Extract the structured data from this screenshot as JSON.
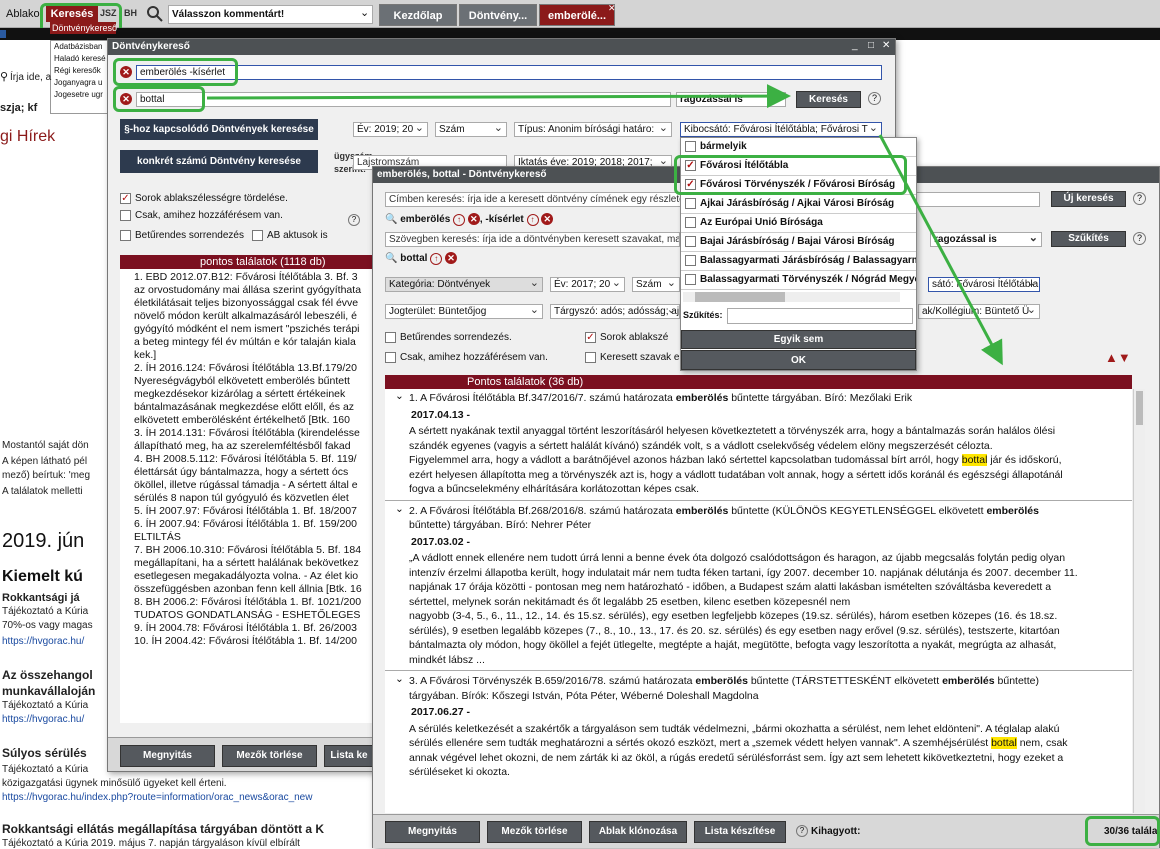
{
  "topbar": {
    "app": "Ablako",
    "search_tab": "Keresés",
    "badge": "JSZ",
    "badge2": "BH",
    "comment_placeholder": "Válasszon kommentárt!",
    "tabs": [
      "Kezdőlap",
      "Döntvény...",
      "emberölé..."
    ]
  },
  "menu": {
    "items": [
      "Döntvénykereső",
      "Adatbázisban",
      "Haladó keresé",
      "Régi keresők",
      "Joganyagra u",
      "Jogesetre ugr"
    ]
  },
  "bg": {
    "search_ph": "Írja ide, a",
    "szja": "szja; kf",
    "news": "gi Hírek",
    "notice1": "Mostantól saját dön",
    "notice2": "A képen látható pél",
    "notice3": "mező) beírtuk: 'meg",
    "notice4": "A találatok melletti",
    "date": "2019. jún",
    "h1": "Kiemelt kú",
    "h1b": "Rokkantsági já",
    "t1": "Tájékoztató a Kúria",
    "t2": "70%-os vagy magas",
    "link1": "https://hvgorac.hu/",
    "h2a": "Az összehangol",
    "h2b": "munkavállaloján",
    "t3": "Tájékoztató a Kúria",
    "link2": "https://hvgorac.hu/",
    "h3": "Súlyos sérülés",
    "t4": "Tájékoztató a Kúria",
    "t5": "közigazgatási ügynek minősülő ügyeket kell érteni.",
    "link3": "https://hvgorac.hu/index.php?route=information/orac_news&orac_new",
    "h4": "Rokkantsági ellátás megállapítása tárgyában döntött a K",
    "t6": "Tájékoztató a Kúria 2019. május 7. napján tárgyaláson kívül elbírált"
  },
  "w1": {
    "title": "Döntvénykereső",
    "q1": "emberölés -kísérlet",
    "q2": "bottal",
    "ragoz": "ragozással is",
    "search_btn": "Keresés",
    "btn_para": "§-hoz kapcsolódó Döntvények keresése",
    "btn_num": "konkrét számú Döntvény keresése",
    "ev": "Év: 2019; 20",
    "szam": "Szám",
    "tipus": "Típus: Anonim bírósági határo:",
    "kibocsato": "Kibocsátó: Fővárosi Ítélőtábla; Fővárosi T",
    "ugyszam": "ügyszám",
    "szerint": "szerint:",
    "lajstrom": "Lajstromszám",
    "iktatas": "Iktatás éve: 2019; 2018; 2017;",
    "opt1": "Sorok ablakszélességre tördelése.",
    "opt2": "Csak, amihez hozzáférésem van.",
    "opt3": "Betűrendes sorrendezés",
    "opt4": "AB aktusok is",
    "results_header": "pontos találatok (1118 db)",
    "lines": [
      "1. EBD 2012.07.B12: Fővárosi Ítélőtábla 3. Bf. 3",
      "az orvostudomány mai állása szerint gyógyíthata",
      "életkilátásait teljes bizonyossággal csak fél évve",
      "növelő módon került alkalmazásáról lebeszéli, é",
      "gyógyító módként el nem ismert \"pszichés terápi",
      "a beteg mintegy fél év múltán e kór talaján kiala",
      "kek.]",
      "2. ÍH 2016.124: Fővárosi Ítélőtábla 13.Bf.179/20",
      "Nyereségvágyból elkövetett emberölés bűntett",
      "megkezdésekor kizárólag a sértett értékeinek",
      "bántalmazásának megkezdése előtt előll, és az",
      "elkövetett emberölésként értékelhető [Btk. 160",
      "3. ÍH 2014.131: Fővárosi Ítélőtábla (kirendelésse",
      "állapítható meg, ha az szerelemféltésből fakad",
      "4. BH 2008.5.112: Fővárosi Ítélőtábla 5. Bf. 119/",
      "élettársát úgy bántalmazza, hogy a sértett ócs",
      "ököllel, illetve rúgással támadja - A sértett által e",
      "sérülés 8 napon túl gyógyuló és közvetlen élet",
      "5. ÍH 2007.97: Fővárosi Ítélőtábla 1. Bf. 18/2007",
      "6. ÍH 2007.94: Fővárosi Ítélőtábla 1. Bf. 159/200",
      "ELTILTÁS",
      "7. BH 2006.10.310: Fővárosi Ítélőtábla 5. Bf. 184",
      "megállapítani, ha a sértett halálának bekövetkez",
      "esetlegesen megakadályozta volna. - Az élet kio",
      "összefüggésben azonban fenn kell állnia [Btk. 16",
      "8. BH 2006.2: Fővárosi Ítélőtábla 1. Bf. 1021/200",
      "TUDATOS GONDATLANSÁG - ESHETŐLEGES",
      "9. ÍH 2004.78: Fővárosi Ítélőtábla 1. Bf. 26/2003",
      "10. ÍH 2004.42: Fővárosi Ítélőtábla 1. Bf. 14/200"
    ],
    "f_btn1": "Megnyitás",
    "f_btn2": "Mezők törlése",
    "f_btn3": "Lista ke"
  },
  "w2": {
    "title": "emberölés, bottal - Döntvénykereső",
    "cim_ph": "Címben keresés: írja ide a keresett döntvény címének egy részletét,",
    "term1": "emberölés",
    "term2": "-kísérlet",
    "uj": "Új keresés",
    "szoveg_ph": "Szövegben keresés: írja ide a döntvényben keresett szavakat, majd",
    "ragoz": "ragozással is",
    "szukites_btn": "Szűkítés",
    "term3": "bottal",
    "kategoria": "Kategória: Döntvények",
    "ev": "Év: 2017; 20",
    "szam": "Szám",
    "kibocsato": "sátó: Fővárosi Ítélőtábla;",
    "jogterulet": "Jogterület: Büntetőjog",
    "targyszo": "Tárgyszó: adós; adósság; ajá",
    "kollegium": "ak/Kollégium: Büntető Ü",
    "opt1": "Betűrendes sorrendezés.",
    "opt2": "Sorok ablakszé",
    "opt3": "Csak, amihez hozzáférésem van.",
    "opt4": "Keresett szavak e",
    "results_header": "Pontos találatok (36 db)",
    "r1": {
      "head_a": "1. A Fővárosi Ítélőtábla Bf.347/2016/7. számú határozata ",
      "head_b": "emberölés",
      "head_c": " bűntette tárgyában. Bíró: Mezőlaki Erik",
      "date": "2017.04.13 -",
      "l1": "A sértett nyakának textil anyaggal történt leszorításáról helyesen következtetett a törvényszék arra, hogy a bántalmazás során halálos ölési",
      "l2": "szándék egyenes (vagyis a sértett halálát kívánó) szándék volt, s a vádlott cselekvőség védelem elöny megszerzését célozta.",
      "l3a": "Figyelemmel arra, hogy a vádlott a barátnőjével azonos házban lakó sértettel kapcsolatban tudomással bírt arról, hogy ",
      "l3b": "bottal",
      "l3c": " jár és időskorú,",
      "l4": "ezért helyesen állapította meg a törvényszék azt is, hogy a vádlott tudatában volt annak, hogy a sértett idős koránál és egészségi állapotánál",
      "l5": "fogva a bűncselekmény elhárítására korlátozottan képes csak."
    },
    "r2": {
      "head_a": "2. A Fővárosi Ítélőtábla Bf.268/2016/8. számú határozata ",
      "head_b": "emberölés",
      "head_c": " bűntette (KÜLÖNÖS KEGYETLENSÉGGEL elkövetett ",
      "head_d": "emberölés",
      "head_e": "bűntette) tárgyában. Bíró: Nehrer Péter",
      "date": "2017.03.02 -",
      "lines": [
        "„A vádlott ennek ellenére nem tudott úrrá lenni a benne évek óta dolgozó csalódottságon és haragon, az újabb megcsalás folytán pedig olyan",
        "intenzív érzelmi állapotba került, hogy indulatait már nem tudta féken tartani, így 2007. december 10. napjának délutánja és 2007. december 11.",
        "napjának 17 órája közötti - pontosan meg nem határozható - időben, a Budapest szám alatti lakásban ismételten szóváltásba keveredett a",
        "sértettel, melynek során nekitámadt és őt legalább 25 esetben, kilenc esetben közepesnél nem",
        "nagyobb (3-4, 5., 6., 11., 12., 14. és 15.sz. sérülés), egy esetben legfeljebb közepes (19.sz. sérülés), három esetben közepes (16. és 18.sz.",
        "sérülés), 9 esetben legalább közepes (7., 8., 10., 13., 17. és 20. sz. sérülés) és egy esetben nagy erővel (9.sz. sérülés), testszerte, kitartóan",
        "bántalmazta oly módon, hogy ököllel a fejét ütlegelte, megtépte a haját, megütötte, befogta vagy leszorította a nyakát, megrúgta az alhasát,",
        "mindkét lábsz ..."
      ]
    },
    "r3": {
      "head_a": "3. A Fővárosi Törvényszék B.659/2016/78. számú határozata ",
      "head_b": "emberölés",
      "head_c": " bűntette (TÁRSTETTESKÉNT elkövetett ",
      "head_d": "emberölés",
      "head_e": " bűntette)",
      "head_f": "tárgyában. Bírók: Kőszegi István, Póta Péter, Wéberné Doleshall Magdolna",
      "date": "2017.06.27 -",
      "l1": "A sérülés keletkezését a szakértők a tárgyaláson sem tudták védelmezni, „bármi okozhatta a sérülést, nem lehet eldönteni\". A téglalap alakú",
      "l2": "sérülés ellenére sem tudták meghatározni a sértés okozó eszközt, mert a „szemek védett helyen vannak\". A szemhéjsérülést ",
      "l2b": "bottal",
      "l2c": " nem, csak",
      "l3": "annak végével lehet okozni, de nem zárták ki az ököl, a rúgás eredetű sérülésforrást sem. Így azt sem lehetett kikövetkeztetni, hogy ezeket a",
      "l4": "sérüléseket ki okozta."
    },
    "f_btn1": "Megnyitás",
    "f_btn2": "Mezők törlése",
    "f_btn3": "Ablak klónozása",
    "f_btn4": "Lista készítése",
    "kihagyott": "Kihagyott:",
    "count": "30/36 találat"
  },
  "dropdown": {
    "options": [
      {
        "label": "bármelyik",
        "checked": false
      },
      {
        "label": "Fővárosi Ítélőtábla",
        "checked": true
      },
      {
        "label": "Fővárosi Törvényszék / Fővárosi Bíróság",
        "checked": true
      },
      {
        "label": "Ajkai Járásbíróság / Ajkai Városi Bíróság",
        "checked": false
      },
      {
        "label": "Az Európai Unió Bírósága",
        "checked": false
      },
      {
        "label": "Bajai Járásbíróság / Bajai Városi Bíróság",
        "checked": false
      },
      {
        "label": "Balassagyarmati Járásbíróság / Balassagyarmat",
        "checked": false
      },
      {
        "label": "Balassagyarmati Törvényszék / Nógrád Megye",
        "checked": false
      }
    ],
    "szukites": "Szűkítés:",
    "egyik": "Egyik sem",
    "ok": "OK"
  },
  "colors": {
    "dark_red": "#7b1020",
    "green": "#3cb043",
    "navy": "#2d3a4e"
  }
}
